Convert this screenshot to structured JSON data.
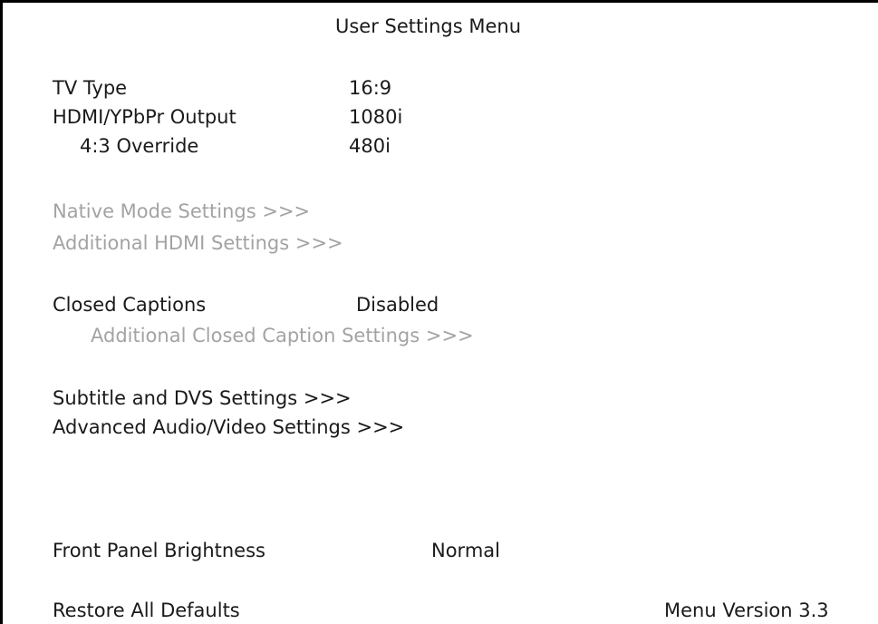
{
  "menu": {
    "title": "User Settings Menu",
    "tv_type": {
      "label": "TV Type",
      "value": "16:9"
    },
    "hdmi_output": {
      "label": "HDMI/YPbPr Output",
      "value": "1080i"
    },
    "override": {
      "label": "4:3 Override",
      "value": "480i"
    },
    "native_mode": "Native Mode Settings >>>",
    "additional_hdmi": "Additional HDMI Settings >>>",
    "closed_captions": {
      "label": "Closed Captions",
      "value": "Disabled"
    },
    "additional_cc": "Additional Closed Caption Settings >>>",
    "subtitle_dvs": "Subtitle and DVS Settings >>>",
    "advanced_av": "Advanced Audio/Video Settings >>>",
    "front_panel": {
      "label": "Front Panel Brightness",
      "value": "Normal"
    },
    "restore_defaults": "Restore All Defaults",
    "version": "Menu Version 3.3"
  },
  "colors": {
    "text": "#1a1a1a",
    "disabled_text": "#a3a3a3",
    "background": "#ffffff",
    "border": "#000000"
  }
}
